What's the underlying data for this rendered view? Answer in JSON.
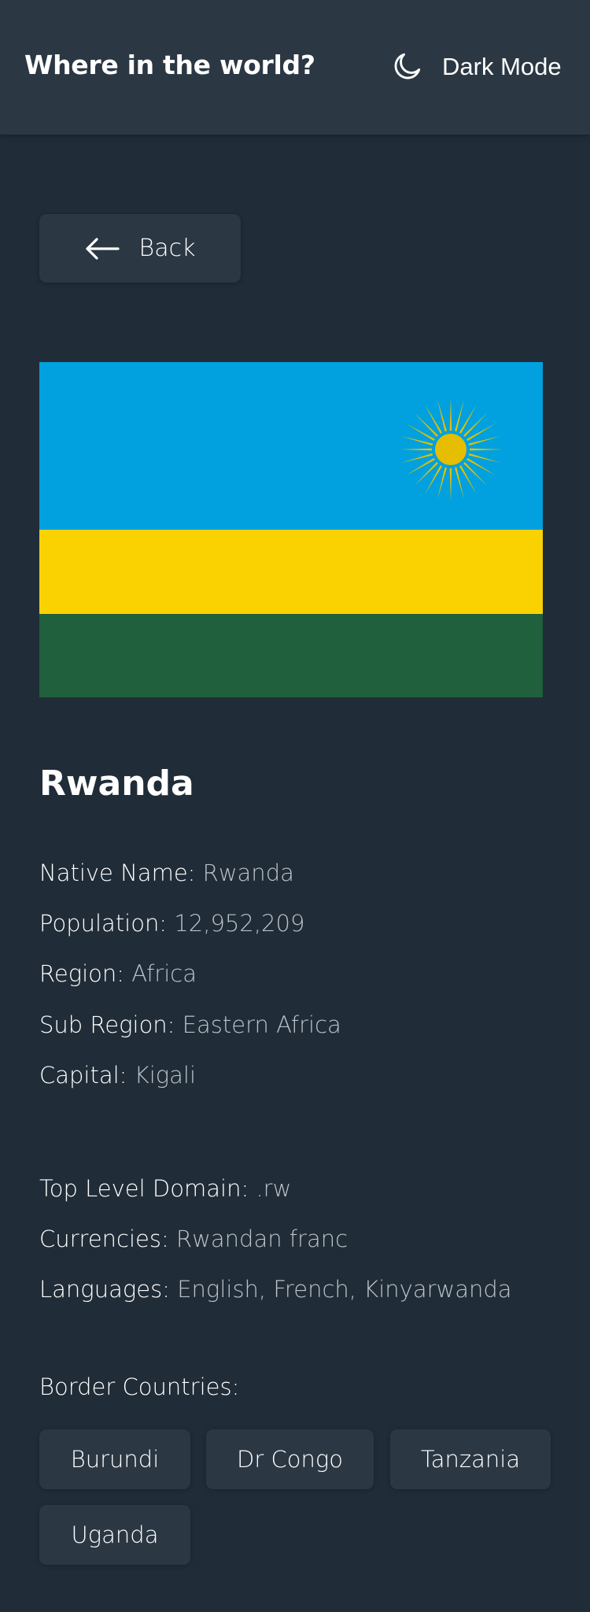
{
  "header": {
    "title": "Where in the world?",
    "mode_icon": "moon-icon",
    "mode_label": "Dark Mode"
  },
  "back": {
    "icon": "arrow-left-icon",
    "label": "Back"
  },
  "flag": {
    "description_icon": "rwanda-flag",
    "colors": {
      "blue": "#00a1de",
      "yellow": "#fad201",
      "green": "#20603d",
      "sun": "#e5be01"
    }
  },
  "country": {
    "name": "Rwanda",
    "native_name_label": "Native Name:",
    "native_name": "Rwanda",
    "population_label": "Population:",
    "population": "12,952,209",
    "region_label": "Region:",
    "region": "Africa",
    "sub_region_label": "Sub Region:",
    "sub_region": "Eastern Africa",
    "capital_label": "Capital:",
    "capital": "Kigali",
    "tld_label": "Top Level Domain:",
    "tld": ".rw",
    "currencies_label": "Currencies:",
    "currencies": "Rwandan franc",
    "languages_label": "Languages:",
    "languages": "English, French, Kinyarwanda"
  },
  "borders": {
    "label": "Border Countries:",
    "items": [
      "Burundi",
      "Dr Congo",
      "Tanzania",
      "Uganda"
    ]
  },
  "theme": {
    "background": "#202c37",
    "elements": "#2b3743",
    "muted_text": "#bcc2c8"
  }
}
